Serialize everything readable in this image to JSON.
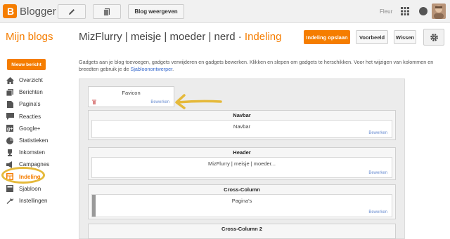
{
  "topbar": {
    "brand": "Blogger",
    "view_blog_label": "Blog weergeven",
    "user_name": "Fleur"
  },
  "header": {
    "my_blogs": "Mijn blogs",
    "blog_name": "MizFlurry | meisje | moeder | nerd",
    "separator": "·",
    "section": "Indeling",
    "save_label": "Indeling opslaan",
    "preview_label": "Voorbeeld",
    "clear_label": "Wissen"
  },
  "sidebar": {
    "new_post": "Nieuw bericht",
    "items": [
      {
        "label": "Overzicht",
        "icon": "home-icon"
      },
      {
        "label": "Berichten",
        "icon": "posts-icon"
      },
      {
        "label": "Pagina's",
        "icon": "pages-icon"
      },
      {
        "label": "Reacties",
        "icon": "comments-icon"
      },
      {
        "label": "Google+",
        "icon": "google-plus-icon"
      },
      {
        "label": "Statistieken",
        "icon": "stats-icon"
      },
      {
        "label": "Inkomsten",
        "icon": "trophy-icon"
      },
      {
        "label": "Campagnes",
        "icon": "campaigns-icon"
      },
      {
        "label": "Indeling",
        "icon": "layout-icon"
      },
      {
        "label": "Sjabloon",
        "icon": "template-icon"
      },
      {
        "label": "Instellingen",
        "icon": "wrench-icon"
      }
    ]
  },
  "main": {
    "intro_text": "Gadgets aan je blog toevoegen, gadgets verwijderen en gadgets bewerken. Klikken en slepen om gadgets te herschikken. Voor het wijzigen van kolommen en breedten gebruik je de ",
    "intro_link": "Sjabloonontwerper",
    "intro_end": ".",
    "edit_label": "Bewerken",
    "favicon": "Favicon",
    "sections": {
      "navbar": {
        "title": "Navbar",
        "gadget": "Navbar"
      },
      "header": {
        "title": "Header",
        "gadget": "MizFlurry | meisje | moeder..."
      },
      "cross": {
        "title": "Cross-Column",
        "gadget": "Pagina's"
      },
      "cross2": {
        "title": "Cross-Column 2"
      }
    }
  },
  "colors": {
    "accent": "#f57d00",
    "link": "#3366cc",
    "annotation": "#e5b93a"
  }
}
